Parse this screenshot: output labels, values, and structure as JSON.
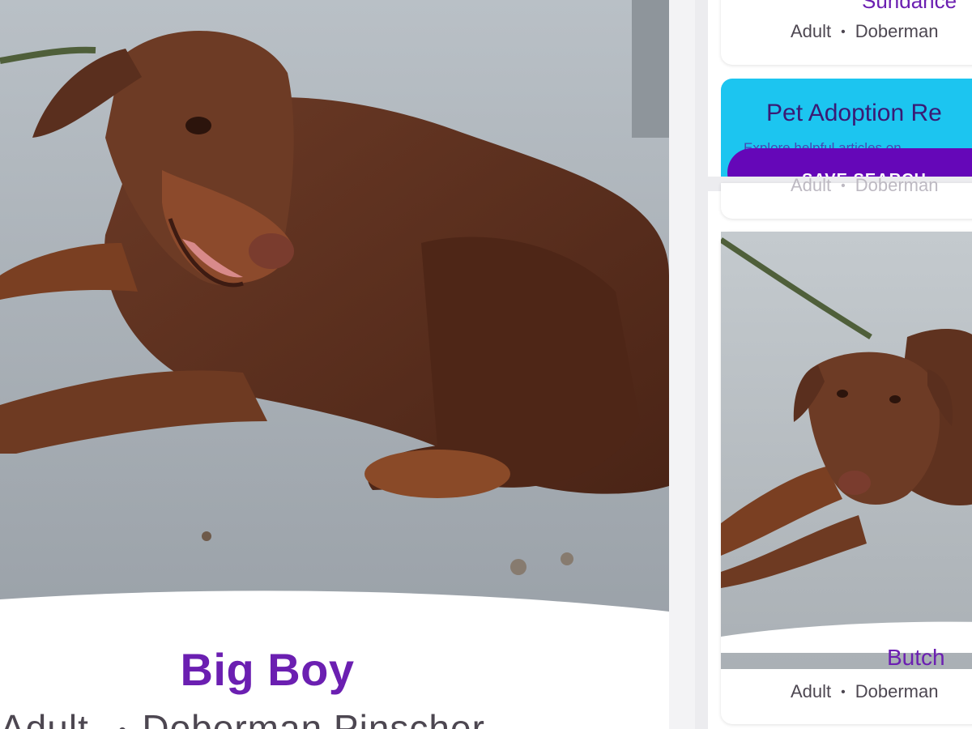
{
  "main_card": {
    "name": "Big Boy",
    "meta": [
      "Adult",
      "Doberman Pinscher"
    ],
    "separator": "•"
  },
  "cards": {
    "sundance": {
      "name": "Sundance",
      "age": "Adult",
      "breed": "Doberman",
      "separator": "•"
    },
    "peek": {
      "age": "Adult",
      "breed": "Doberman",
      "separator": "•"
    },
    "butch": {
      "name": "Butch",
      "age": "Adult",
      "breed": "Doberman",
      "separator": "•"
    }
  },
  "resources": {
    "title": "Pet Adoption Re",
    "subtitle": "Explore helpful articles on",
    "save_button": "SAVE SEARCH"
  },
  "colors": {
    "name_purple": "#6b1fb1",
    "resources_blue": "#1cc5f0",
    "button_purple": "#6507b8"
  }
}
